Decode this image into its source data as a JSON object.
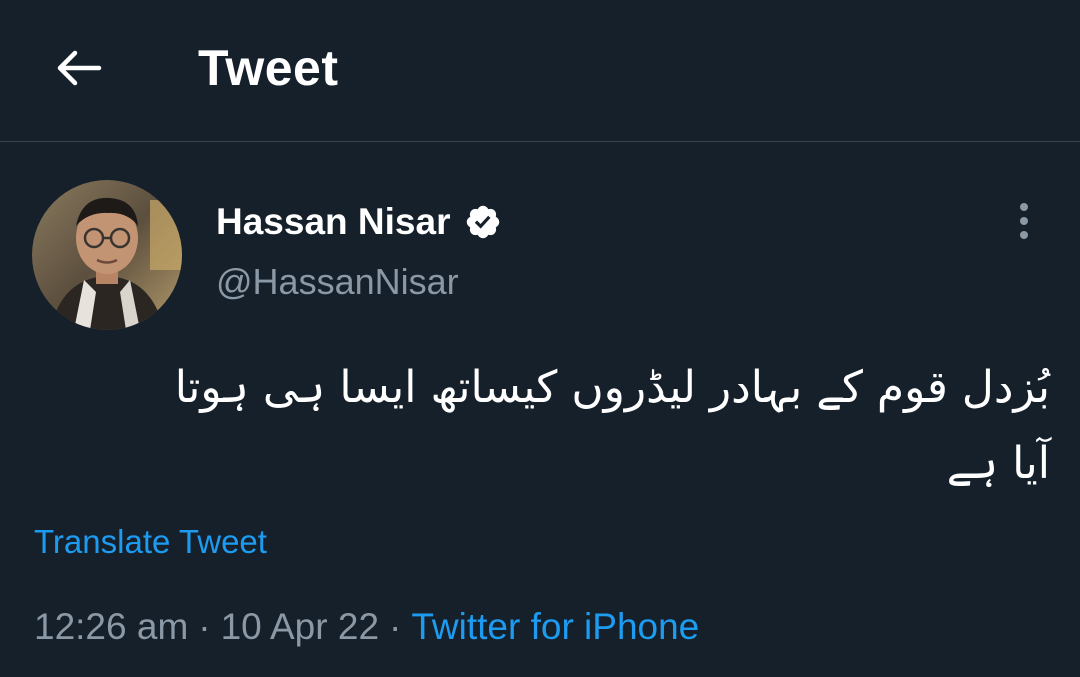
{
  "header": {
    "title": "Tweet",
    "back_icon": "arrow-left-icon"
  },
  "tweet": {
    "author": {
      "name": "Hassan Nisar",
      "handle": "@HassanNisar",
      "verified": true,
      "verified_icon": "verified-badge-icon"
    },
    "more_icon": "more-vertical-icon",
    "text_line1": "بُزدل قوم کے بہادر لیڈروں کیساتھ ایسا ہی ہوتا",
    "text_line2": "آیا ہے",
    "translate_label": "Translate Tweet",
    "time": "12:26 am",
    "separator": "·",
    "date": "10 Apr 22",
    "source": "Twitter for iPhone"
  },
  "colors": {
    "background": "#15202b",
    "divider": "#38444d",
    "secondary_text": "#8b98a5",
    "link": "#1d9bf0",
    "primary_text": "#ffffff"
  }
}
